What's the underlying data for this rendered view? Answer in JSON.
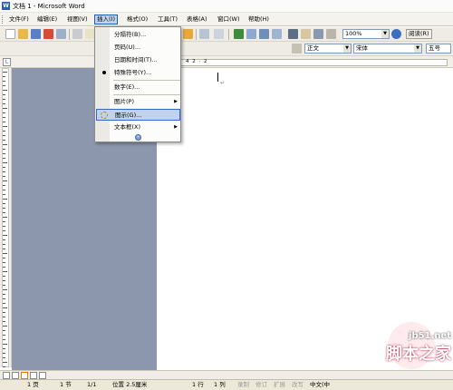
{
  "window": {
    "title": "文档 1 - Microsoft Word"
  },
  "menubar": [
    "文件(F)",
    "编辑(E)",
    "视图(V)",
    "插入(I)",
    "格式(O)",
    "工具(T)",
    "表格(A)",
    "窗口(W)",
    "帮助(H)"
  ],
  "toolbar": {
    "zoom": "100%",
    "read_button": "阅读(R)",
    "style": "正文",
    "font": "宋体",
    "font_size": "五号"
  },
  "insert_menu": {
    "items": [
      "分隔符(B)...",
      "页码(U)...",
      "日期和时间(T)...",
      "特殊符号(Y)...",
      "数字(E)...",
      "图片(P)",
      "图示(G)...",
      "文本框(X)"
    ],
    "expand": "»"
  },
  "ruler": {
    "corner": "L",
    "numbers": "4  2  ·  2"
  },
  "statusbar": {
    "page": "1 页",
    "section": "1 节",
    "pages": "1/1",
    "position": "位置 2.5厘米",
    "line": "1 行",
    "column": "1 列",
    "rec": "录制",
    "trk": "修订",
    "ext": "扩展",
    "ovr": "改写",
    "lang": "中文(中"
  },
  "watermark": {
    "domain": "jb51.net",
    "site": "脚本之家"
  },
  "colors": {
    "accent": "#316ac5",
    "highlight": "#c1d2ee",
    "page_bg": "#8c97ad"
  }
}
